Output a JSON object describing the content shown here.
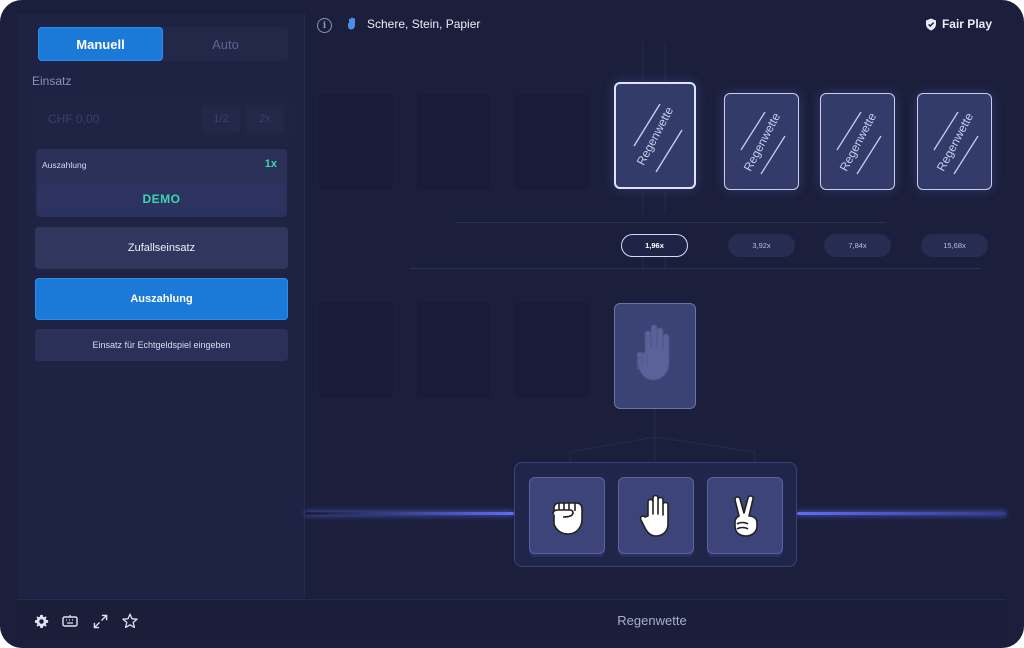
{
  "sidebar": {
    "tabs": [
      {
        "label": "Manuell",
        "active": true
      },
      {
        "label": "Auto",
        "active": false
      }
    ],
    "einsatz_label": "Einsatz",
    "stake": {
      "value": "CHF 0,00",
      "half_label": "1/2",
      "double_label": "2x"
    },
    "payout": {
      "label": "Auszahlung",
      "multiplier": "1x",
      "value": "DEMO"
    },
    "random_bet_label": "Zufallseinsatz",
    "payout_button_label": "Auszahlung",
    "real_money_label": "Einsatz für Echtgeldspiel eingeben"
  },
  "header": {
    "title": "Schere, Stein, Papier",
    "fair_play": "Fair Play"
  },
  "game": {
    "card_label": "Regenwette",
    "multipliers": [
      "1,96x",
      "3,92x",
      "7,84x",
      "15,68x"
    ],
    "choices": [
      {
        "name": "rock",
        "icon": "fist-icon"
      },
      {
        "name": "paper",
        "icon": "open-hand-icon"
      },
      {
        "name": "scissors",
        "icon": "victory-hand-icon"
      }
    ]
  },
  "bottom": {
    "status": "Regenwette",
    "icons": [
      "gear-icon",
      "keyboard-icon",
      "expand-icon",
      "star-icon"
    ]
  },
  "colors": {
    "accent": "#1b7ad8",
    "demo_green": "#3ad6b0",
    "background": "#1b1f3b"
  }
}
